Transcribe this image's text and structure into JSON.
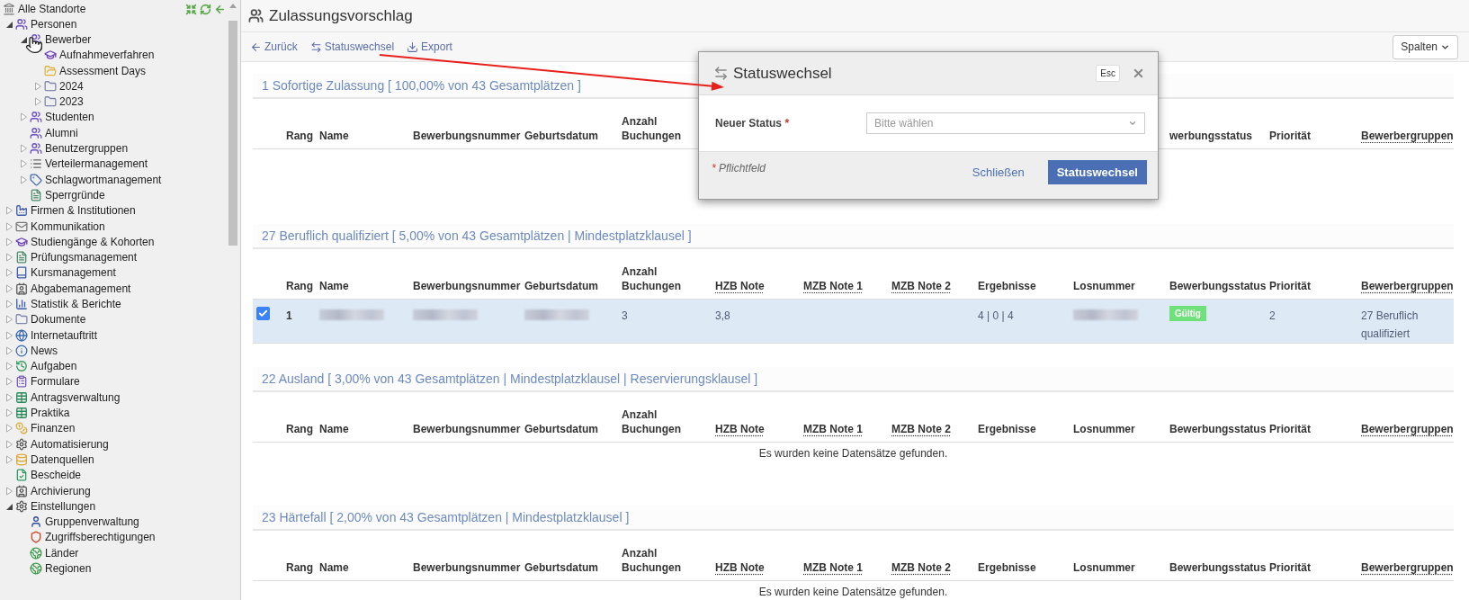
{
  "sidebar": {
    "root": "Alle Standorte",
    "items": [
      {
        "label": "Personen",
        "kind": "people",
        "expanded": true,
        "children": [
          {
            "label": "Bewerber",
            "kind": "people",
            "expanded": true,
            "children": [
              {
                "label": "Aufnahmeverfahren",
                "kind": "cap"
              },
              {
                "label": "Assessment Days",
                "kind": "openfolder"
              },
              {
                "label": "2024",
                "kind": "folder",
                "expanded": false
              },
              {
                "label": "2023",
                "kind": "folder",
                "expanded": false
              }
            ]
          },
          {
            "label": "Studenten",
            "kind": "people",
            "expanded": false
          },
          {
            "label": "Alumni",
            "kind": "people"
          },
          {
            "label": "Benutzergruppen",
            "kind": "people",
            "expanded": false
          },
          {
            "label": "Verteilermanagement",
            "kind": "list",
            "expanded": false
          },
          {
            "label": "Schlagwortmanagement",
            "kind": "tag",
            "expanded": false
          },
          {
            "label": "Sperrgründe",
            "kind": "sheet"
          }
        ]
      },
      {
        "label": "Firmen & Institutionen",
        "kind": "factory",
        "expanded": false
      },
      {
        "label": "Kommunikation",
        "kind": "mail",
        "expanded": false
      },
      {
        "label": "Studiengänge & Kohorten",
        "kind": "cap",
        "expanded": false
      },
      {
        "label": "Prüfungsmanagement",
        "kind": "sheet",
        "expanded": false
      },
      {
        "label": "Kursmanagement",
        "kind": "book",
        "expanded": false
      },
      {
        "label": "Abgabemanagement",
        "kind": "card",
        "expanded": false
      },
      {
        "label": "Statistik & Berichte",
        "kind": "chart",
        "expanded": false
      },
      {
        "label": "Dokumente",
        "kind": "folder",
        "expanded": false
      },
      {
        "label": "Internetauftritt",
        "kind": "globe",
        "expanded": false
      },
      {
        "label": "News",
        "kind": "info",
        "expanded": false
      },
      {
        "label": "Aufgaben",
        "kind": "clock",
        "expanded": false
      },
      {
        "label": "Formulare",
        "kind": "form",
        "expanded": false
      },
      {
        "label": "Antragsverwaltung",
        "kind": "table",
        "expanded": false
      },
      {
        "label": "Praktika",
        "kind": "table",
        "expanded": false
      },
      {
        "label": "Finanzen",
        "kind": "coins",
        "expanded": false
      },
      {
        "label": "Automatisierung",
        "kind": "gear",
        "expanded": false
      },
      {
        "label": "Datenquellen",
        "kind": "db",
        "expanded": false
      },
      {
        "label": "Bescheide",
        "kind": "doc"
      },
      {
        "label": "Archivierung",
        "kind": "card",
        "expanded": false
      },
      {
        "label": "Einstellungen",
        "kind": "gear",
        "expanded": true,
        "children": [
          {
            "label": "Gruppenverwaltung",
            "kind": "user"
          },
          {
            "label": "Zugriffsberechtigungen",
            "kind": "shield"
          },
          {
            "label": "Länder",
            "kind": "earth"
          },
          {
            "label": "Regionen",
            "kind": "earth"
          }
        ]
      }
    ]
  },
  "page": {
    "title": "Zulassungsvorschlag"
  },
  "toolbar": {
    "actions": [
      {
        "label": "Zurück",
        "kind": "back"
      },
      {
        "label": "Statuswechsel",
        "kind": "swap"
      },
      {
        "label": "Export",
        "kind": "export"
      }
    ],
    "columns_button": "Spalten"
  },
  "sections": [
    {
      "title": "1 Sofortige Zulassung [ 100,00% von 43 Gesamtplätzen ]",
      "columns_before_dialog": [
        {
          "label": "Rang",
          "tooltip": false
        },
        {
          "label": "Name",
          "tooltip": false
        },
        {
          "label": "Bewerbungsnummer",
          "tooltip": false
        },
        {
          "label": "Geburtsdatum",
          "tooltip": false
        },
        {
          "label": "Anzahl Buchungen",
          "tooltip": false
        }
      ],
      "columns_after_dialog": [
        {
          "label": "werbungsstatus",
          "tooltip": false
        },
        {
          "label": "Priorität",
          "tooltip": false
        },
        {
          "label": "Bewerbergruppen",
          "tooltip": true
        }
      ]
    },
    {
      "title": "27 Beruflich qualifiziert [ 5,00% von 43 Gesamtplätzen | Mindestplatzklausel ]",
      "columns": [
        {
          "label": "Rang",
          "tooltip": false
        },
        {
          "label": "Name",
          "tooltip": false
        },
        {
          "label": "Bewerbungsnummer",
          "tooltip": false
        },
        {
          "label": "Geburtsdatum",
          "tooltip": false
        },
        {
          "label": "Anzahl Buchungen",
          "tooltip": false
        },
        {
          "label": "HZB Note",
          "tooltip": true
        },
        {
          "label": "MZB Note 1",
          "tooltip": true
        },
        {
          "label": "MZB Note 2",
          "tooltip": true
        },
        {
          "label": "Ergebnisse",
          "tooltip": false
        },
        {
          "label": "Losnummer",
          "tooltip": false
        },
        {
          "label": "Bewerbungsstatus",
          "tooltip": false
        },
        {
          "label": "Priorität",
          "tooltip": false
        },
        {
          "label": "Bewerbergruppen",
          "tooltip": true
        }
      ],
      "rows": [
        {
          "selected": true,
          "checked": true,
          "cells": [
            {
              "kind": "bold",
              "text": "1"
            },
            {
              "kind": "redacted"
            },
            {
              "kind": "redacted"
            },
            {
              "kind": "redacted"
            },
            {
              "kind": "text",
              "text": "3"
            },
            {
              "kind": "text",
              "text": "3,8"
            },
            {
              "kind": "empty"
            },
            {
              "kind": "empty"
            },
            {
              "kind": "text",
              "text": "4 | 0 | 4"
            },
            {
              "kind": "redacted"
            },
            {
              "kind": "badge",
              "text": "Gültig"
            },
            {
              "kind": "text",
              "text": "2"
            },
            {
              "kind": "text",
              "text": "27 Beruflich qualifiziert"
            }
          ]
        }
      ]
    },
    {
      "title": "22 Ausland [ 3,00% von 43 Gesamtplätzen | Mindestplatzklausel | Reservierungsklausel ]",
      "columns": [
        {
          "label": "Rang",
          "tooltip": false
        },
        {
          "label": "Name",
          "tooltip": false
        },
        {
          "label": "Bewerbungsnummer",
          "tooltip": false
        },
        {
          "label": "Geburtsdatum",
          "tooltip": false
        },
        {
          "label": "Anzahl Buchungen",
          "tooltip": false
        },
        {
          "label": "HZB Note",
          "tooltip": true
        },
        {
          "label": "MZB Note 1",
          "tooltip": true
        },
        {
          "label": "MZB Note 2",
          "tooltip": true
        },
        {
          "label": "Ergebnisse",
          "tooltip": false
        },
        {
          "label": "Losnummer",
          "tooltip": false
        },
        {
          "label": "Bewerbungsstatus",
          "tooltip": false
        },
        {
          "label": "Priorität",
          "tooltip": false
        },
        {
          "label": "Bewerbergruppen",
          "tooltip": true
        }
      ],
      "empty_message": "Es wurden keine Datensätze gefunden."
    },
    {
      "title": "23 Härtefall [ 2,00% von 43 Gesamtplätzen | Mindestplatzklausel ]",
      "columns": [
        {
          "label": "Rang",
          "tooltip": false
        },
        {
          "label": "Name",
          "tooltip": false
        },
        {
          "label": "Bewerbungsnummer",
          "tooltip": false
        },
        {
          "label": "Geburtsdatum",
          "tooltip": false
        },
        {
          "label": "Anzahl Buchungen",
          "tooltip": false
        },
        {
          "label": "HZB Note",
          "tooltip": true
        },
        {
          "label": "MZB Note 1",
          "tooltip": true
        },
        {
          "label": "MZB Note 2",
          "tooltip": true
        },
        {
          "label": "Ergebnisse",
          "tooltip": false
        },
        {
          "label": "Losnummer",
          "tooltip": false
        },
        {
          "label": "Bewerbungsstatus",
          "tooltip": false
        },
        {
          "label": "Priorität",
          "tooltip": false
        },
        {
          "label": "Bewerbergruppen",
          "tooltip": true
        }
      ],
      "empty_message": "Es wurden keine Datensätze gefunden."
    }
  ],
  "dialog": {
    "title": "Statuswechsel",
    "esc_hint": "Esc",
    "field": {
      "label": "Neuer Status",
      "required_mark": "*",
      "placeholder": "Bitte wählen"
    },
    "footnote_mark": "*",
    "footnote": "Pflichtfeld",
    "buttons": [
      {
        "label": "Schließen",
        "kind": "link"
      },
      {
        "label": "Statuswechsel",
        "kind": "primary"
      }
    ]
  }
}
